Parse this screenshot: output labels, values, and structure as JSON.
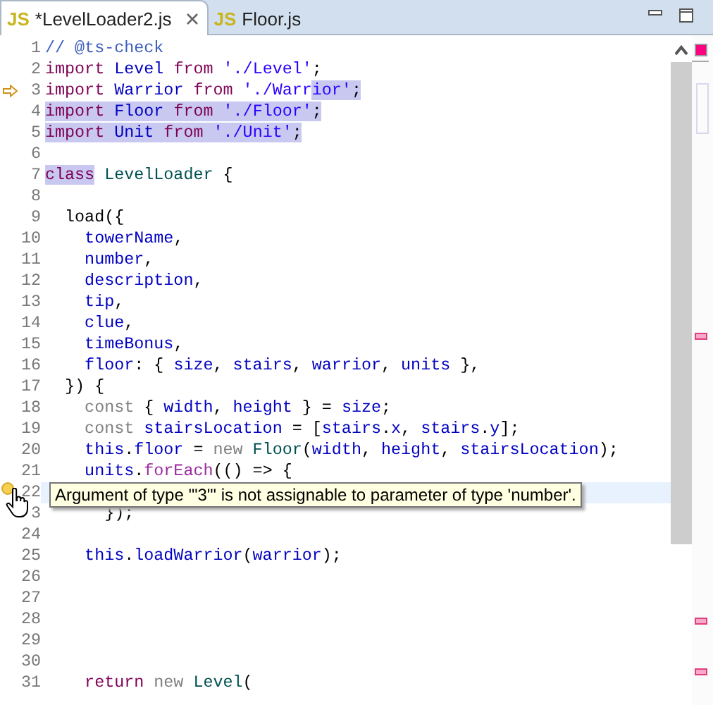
{
  "tabs": [
    {
      "icon": "JS",
      "label": "*LevelLoader2.js",
      "selected": true,
      "closable": true
    },
    {
      "icon": "JS",
      "label": "Floor.js",
      "selected": false,
      "closable": false
    }
  ],
  "editor": {
    "lines": [
      {
        "number": "1",
        "tokens": [
          {
            "text": "// @ts-check",
            "kind": "comment",
            "selected": false
          }
        ]
      },
      {
        "number": "2",
        "tokens": [
          {
            "text": "import",
            "kind": "keyword",
            "selected": false
          },
          {
            "text": " Level",
            "kind": "field",
            "selected": false
          },
          {
            "text": " from",
            "kind": "keyword",
            "selected": false
          },
          {
            "text": " './Level'",
            "kind": "string",
            "selected": false
          },
          {
            "text": ";",
            "kind": "plain",
            "selected": false
          }
        ]
      },
      {
        "number": "3",
        "marker": {
          "kind": "arrow"
        },
        "tokens": [
          {
            "text": "import",
            "kind": "keyword",
            "selected": false
          },
          {
            "text": " Warrior",
            "kind": "field",
            "selected": false
          },
          {
            "text": " from",
            "kind": "keyword",
            "selected": false
          },
          {
            "text": " './Warr",
            "kind": "string",
            "selected": false
          },
          {
            "text": "ior'",
            "kind": "string",
            "selected": true
          },
          {
            "text": ";",
            "kind": "plain",
            "selected": true
          }
        ]
      },
      {
        "number": "4",
        "tokens": [
          {
            "text": "import",
            "kind": "keyword",
            "selected": true
          },
          {
            "text": " Floor",
            "kind": "field",
            "selected": true
          },
          {
            "text": " from",
            "kind": "keyword",
            "selected": true
          },
          {
            "text": " './Floor'",
            "kind": "string",
            "selected": true
          },
          {
            "text": ";",
            "kind": "plain",
            "selected": true
          }
        ]
      },
      {
        "number": "5",
        "tokens": [
          {
            "text": "import",
            "kind": "keyword",
            "selected": true
          },
          {
            "text": " Unit",
            "kind": "field",
            "selected": true
          },
          {
            "text": " from",
            "kind": "keyword",
            "selected": true
          },
          {
            "text": " './Unit'",
            "kind": "string",
            "selected": true
          },
          {
            "text": ";",
            "kind": "plain",
            "selected": true
          }
        ]
      },
      {
        "number": "6"
      },
      {
        "number": "7",
        "tokens": [
          {
            "text": "class",
            "kind": "keyword",
            "selected": true
          },
          {
            "text": " LevelLoader",
            "kind": "type",
            "selected": false
          },
          {
            "text": " {",
            "kind": "plain",
            "selected": false
          }
        ]
      },
      {
        "number": "8"
      },
      {
        "number": "9",
        "tokens": [
          {
            "text": "  load({",
            "kind": "plain",
            "selected": false
          }
        ]
      },
      {
        "number": "10",
        "tokens": [
          {
            "text": "    towerName",
            "kind": "field",
            "selected": false
          },
          {
            "text": ",",
            "kind": "plain",
            "selected": false
          }
        ]
      },
      {
        "number": "11",
        "tokens": [
          {
            "text": "    number",
            "kind": "field",
            "selected": false
          },
          {
            "text": ",",
            "kind": "plain",
            "selected": false
          }
        ]
      },
      {
        "number": "12",
        "tokens": [
          {
            "text": "    description",
            "kind": "field",
            "selected": false
          },
          {
            "text": ",",
            "kind": "plain",
            "selected": false
          }
        ]
      },
      {
        "number": "13",
        "tokens": [
          {
            "text": "    tip",
            "kind": "field",
            "selected": false
          },
          {
            "text": ",",
            "kind": "plain",
            "selected": false
          }
        ]
      },
      {
        "number": "14",
        "tokens": [
          {
            "text": "    clue",
            "kind": "field",
            "selected": false
          },
          {
            "text": ",",
            "kind": "plain",
            "selected": false
          }
        ]
      },
      {
        "number": "15",
        "tokens": [
          {
            "text": "    timeBonus",
            "kind": "field",
            "selected": false
          },
          {
            "text": ",",
            "kind": "plain",
            "selected": false
          }
        ]
      },
      {
        "number": "16",
        "tokens": [
          {
            "text": "    floor",
            "kind": "field",
            "selected": false
          },
          {
            "text": ": { ",
            "kind": "plain",
            "selected": false
          },
          {
            "text": "size",
            "kind": "field",
            "selected": false
          },
          {
            "text": ", ",
            "kind": "plain",
            "selected": false
          },
          {
            "text": "stairs",
            "kind": "field",
            "selected": false
          },
          {
            "text": ", ",
            "kind": "plain",
            "selected": false
          },
          {
            "text": "warrior",
            "kind": "field",
            "selected": false
          },
          {
            "text": ", ",
            "kind": "plain",
            "selected": false
          },
          {
            "text": "units",
            "kind": "field",
            "selected": false
          },
          {
            "text": " },",
            "kind": "plain",
            "selected": false
          }
        ]
      },
      {
        "number": "17",
        "tokens": [
          {
            "text": "  }) {",
            "kind": "plain",
            "selected": false
          }
        ]
      },
      {
        "number": "18",
        "tokens": [
          {
            "text": "    const",
            "kind": "keyword2",
            "selected": false
          },
          {
            "text": " { ",
            "kind": "plain",
            "selected": false
          },
          {
            "text": "width",
            "kind": "field",
            "selected": false
          },
          {
            "text": ", ",
            "kind": "plain",
            "selected": false
          },
          {
            "text": "height",
            "kind": "field",
            "selected": false
          },
          {
            "text": " } = ",
            "kind": "plain",
            "selected": false
          },
          {
            "text": "size",
            "kind": "field",
            "selected": false
          },
          {
            "text": ";",
            "kind": "plain",
            "selected": false
          }
        ]
      },
      {
        "number": "19",
        "tokens": [
          {
            "text": "    const",
            "kind": "keyword2",
            "selected": false
          },
          {
            "text": " stairsLocation",
            "kind": "field",
            "selected": false
          },
          {
            "text": " = [",
            "kind": "plain",
            "selected": false
          },
          {
            "text": "stairs",
            "kind": "field",
            "selected": false
          },
          {
            "text": ".",
            "kind": "plain",
            "selected": false
          },
          {
            "text": "x",
            "kind": "field",
            "selected": false
          },
          {
            "text": ", ",
            "kind": "plain",
            "selected": false
          },
          {
            "text": "stairs",
            "kind": "field",
            "selected": false
          },
          {
            "text": ".",
            "kind": "plain",
            "selected": false
          },
          {
            "text": "y",
            "kind": "field",
            "selected": false
          },
          {
            "text": "];",
            "kind": "plain",
            "selected": false
          }
        ]
      },
      {
        "number": "20",
        "tokens": [
          {
            "text": "    this",
            "kind": "field",
            "selected": false
          },
          {
            "text": ".",
            "kind": "plain",
            "selected": false
          },
          {
            "text": "floor",
            "kind": "field",
            "selected": false
          },
          {
            "text": " = ",
            "kind": "plain",
            "selected": false
          },
          {
            "text": "new",
            "kind": "keyword2",
            "selected": false
          },
          {
            "text": " Floor",
            "kind": "type",
            "selected": false
          },
          {
            "text": "(",
            "kind": "plain",
            "selected": false
          },
          {
            "text": "width",
            "kind": "field",
            "selected": false
          },
          {
            "text": ", ",
            "kind": "plain",
            "selected": false
          },
          {
            "text": "height",
            "kind": "field",
            "selected": false
          },
          {
            "text": ", ",
            "kind": "plain",
            "selected": false
          },
          {
            "text": "stairsLocation",
            "kind": "field",
            "selected": false
          },
          {
            "text": ");",
            "kind": "plain",
            "selected": false
          }
        ]
      },
      {
        "number": "21",
        "tokens": [
          {
            "text": "    units",
            "kind": "field",
            "selected": false
          },
          {
            "text": ".",
            "kind": "plain",
            "selected": false
          },
          {
            "text": "forEach",
            "kind": "method",
            "selected": false
          },
          {
            "text": "(() => {",
            "kind": "plain",
            "selected": false
          }
        ]
      },
      {
        "number": "22",
        "marker": {
          "kind": "warning"
        },
        "current": true
      },
      {
        "number": "3",
        "tokens": [
          {
            "text": "      });",
            "kind": "plain",
            "selected": false
          }
        ]
      },
      {
        "number": "24"
      },
      {
        "number": "25",
        "tokens": [
          {
            "text": "    this",
            "kind": "field",
            "selected": false
          },
          {
            "text": ".",
            "kind": "plain",
            "selected": false
          },
          {
            "text": "loadWarrior",
            "kind": "field",
            "selected": false
          },
          {
            "text": "(",
            "kind": "plain",
            "selected": false
          },
          {
            "text": "warrior",
            "kind": "field",
            "selected": false
          },
          {
            "text": ");",
            "kind": "plain",
            "selected": false
          }
        ]
      },
      {
        "number": "26"
      },
      {
        "number": "27"
      },
      {
        "number": "28"
      },
      {
        "number": "29"
      },
      {
        "number": "30"
      },
      {
        "number": "31",
        "tokens": [
          {
            "text": "    return",
            "kind": "keyword",
            "selected": false
          },
          {
            "text": " new",
            "kind": "keyword2",
            "selected": false
          },
          {
            "text": " Level",
            "kind": "type",
            "selected": false
          },
          {
            "text": "(",
            "kind": "plain",
            "selected": false
          }
        ]
      }
    ],
    "tooltip": {
      "text": "Argument of type '\"3\"' is not assignable to parameter of type 'number'."
    }
  }
}
